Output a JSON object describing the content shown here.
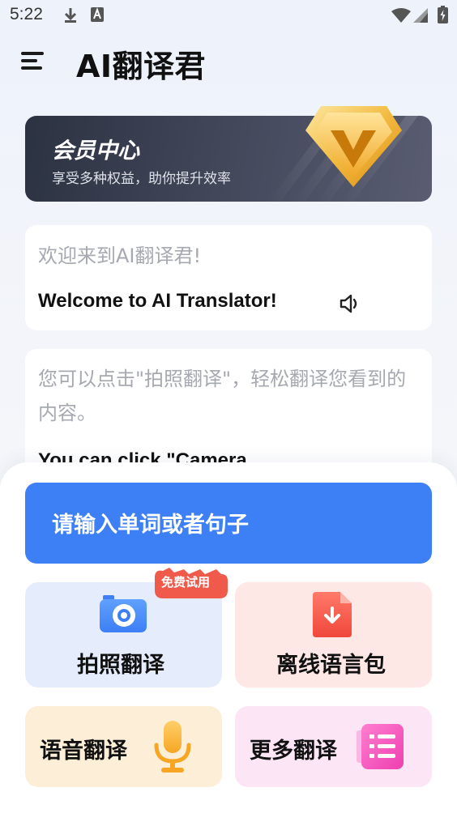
{
  "status_bar": {
    "time": "5:22",
    "icons": [
      "download-icon",
      "a-keyboard-icon",
      "wifi-icon",
      "signal-icon",
      "battery-icon"
    ]
  },
  "header": {
    "title": "AI翻译君",
    "menu_icon": "menu-icon"
  },
  "member": {
    "title": "会员中心",
    "subtitle": "享受多种权益，助你提升效率",
    "badge_icon": "gold-v-badge-icon"
  },
  "messages": [
    {
      "zh": "欢迎来到AI翻译君!",
      "en": "Welcome to AI Translator!",
      "speaker_icon": "speaker-icon"
    },
    {
      "zh": "您可以点击\"拍照翻译\"，轻松翻译您看到的内容。",
      "en": "You can click \"Camera"
    }
  ],
  "input": {
    "placeholder": "请输入单词或者句子"
  },
  "tiles": {
    "camera": {
      "label": "拍照翻译",
      "icon": "camera-icon",
      "badge": "免费试用"
    },
    "offline": {
      "label": "离线语言包",
      "icon": "download-file-icon"
    },
    "voice": {
      "label": "语音翻译",
      "icon": "microphone-icon"
    },
    "more": {
      "label": "更多翻译",
      "icon": "list-icon"
    }
  },
  "colors": {
    "accent": "#3d7ff5",
    "camera_tile": "#e5edfc",
    "offline_tile": "#fde8e6",
    "voice_tile": "#fdeed8",
    "more_tile": "#fce6f6"
  }
}
